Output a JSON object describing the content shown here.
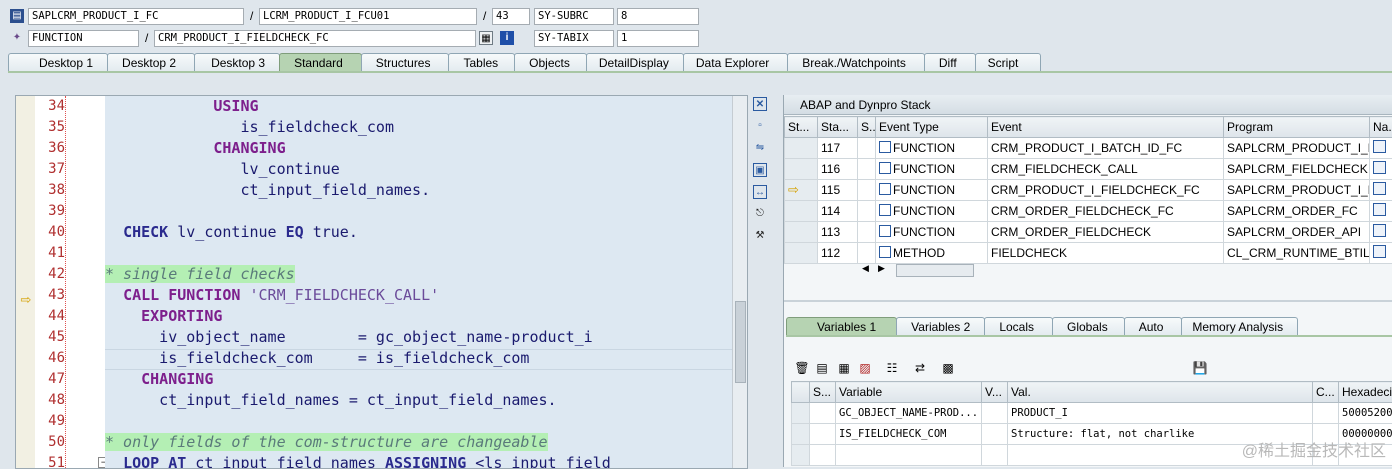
{
  "header": {
    "program": "SAPLCRM_PRODUCT_I_FC",
    "include": "LCRM_PRODUCT_I_FCU01",
    "line": "43",
    "sy_subrc_label": "SY-SUBRC",
    "sy_subrc_value": "8",
    "event_type": "FUNCTION",
    "event_name": "CRM_PRODUCT_I_FIELDCHECK_FC",
    "sy_tabix_label": "SY-TABIX",
    "sy_tabix_value": "1",
    "slash": "/"
  },
  "tabs": [
    {
      "label": "Desktop 1"
    },
    {
      "label": "Desktop 2"
    },
    {
      "label": "Desktop 3"
    },
    {
      "label": "Standard"
    },
    {
      "label": "Structures"
    },
    {
      "label": "Tables"
    },
    {
      "label": "Objects"
    },
    {
      "label": "DetailDisplay"
    },
    {
      "label": "Data Explorer"
    },
    {
      "label": "Break./Watchpoints"
    },
    {
      "label": "Diff"
    },
    {
      "label": "Script"
    }
  ],
  "code": {
    "lines": [
      {
        "num": "34",
        "parts": [
          [
            "sp",
            "            "
          ],
          [
            "kw",
            "USING"
          ]
        ]
      },
      {
        "num": "35",
        "parts": [
          [
            "sp",
            "               is_fieldcheck_com"
          ]
        ]
      },
      {
        "num": "36",
        "parts": [
          [
            "sp",
            "            "
          ],
          [
            "kw",
            "CHANGING"
          ]
        ]
      },
      {
        "num": "37",
        "parts": [
          [
            "sp",
            "               lv_continue"
          ]
        ]
      },
      {
        "num": "38",
        "parts": [
          [
            "sp",
            "               ct_input_field_names."
          ]
        ]
      },
      {
        "num": "39",
        "parts": []
      },
      {
        "num": "40",
        "parts": [
          [
            "sp",
            "  "
          ],
          [
            "kwb",
            "CHECK"
          ],
          [
            "sp",
            " lv_continue "
          ],
          [
            "kwb",
            "EQ"
          ],
          [
            "sp",
            " true."
          ]
        ]
      },
      {
        "num": "41",
        "parts": []
      },
      {
        "num": "42",
        "parts": [
          [
            "cmt",
            "* single field checks"
          ]
        ]
      },
      {
        "num": "43",
        "parts": [
          [
            "sp",
            "  "
          ],
          [
            "kw",
            "CALL FUNCTION"
          ],
          [
            "str",
            " 'CRM_FIELDCHECK_CALL'"
          ]
        ]
      },
      {
        "num": "44",
        "parts": [
          [
            "sp",
            "    "
          ],
          [
            "kw",
            "EXPORTING"
          ]
        ]
      },
      {
        "num": "45",
        "parts": [
          [
            "sp",
            "      iv_object_name        = gc_object_name-product_i"
          ]
        ]
      },
      {
        "num": "46",
        "parts": [
          [
            "sp",
            "      is_fieldcheck_com     = is_fieldcheck_com"
          ]
        ]
      },
      {
        "num": "47",
        "parts": [
          [
            "sp",
            "    "
          ],
          [
            "kw",
            "CHANGING"
          ]
        ]
      },
      {
        "num": "48",
        "parts": [
          [
            "sp",
            "      ct_input_field_names = ct_input_field_names."
          ]
        ]
      },
      {
        "num": "49",
        "parts": []
      },
      {
        "num": "50",
        "parts": [
          [
            "cmt",
            "* only fields of the com-structure are changeable"
          ]
        ]
      },
      {
        "num": "51",
        "parts": [
          [
            "sp",
            "  "
          ],
          [
            "kwb",
            "LOOP AT"
          ],
          [
            "sp",
            " ct_input_field_names "
          ],
          [
            "kwb",
            "ASSIGNING"
          ],
          [
            "sp",
            " <ls_input_field"
          ]
        ]
      }
    ]
  },
  "stack": {
    "title": "ABAP and Dynpro Stack",
    "columns": [
      "St...",
      "Sta...",
      "S...",
      "Event Type",
      "Event",
      "Program",
      "Na..."
    ],
    "rows": [
      {
        "level": "117",
        "type": "FUNCTION",
        "event": "CRM_PRODUCT_I_BATCH_ID_FC",
        "program": "SAPLCRM_PRODUCT_I_FC",
        "current": false
      },
      {
        "level": "116",
        "type": "FUNCTION",
        "event": "CRM_FIELDCHECK_CALL",
        "program": "SAPLCRM_FIELDCHECK",
        "current": false
      },
      {
        "level": "115",
        "type": "FUNCTION",
        "event": "CRM_PRODUCT_I_FIELDCHECK_FC",
        "program": "SAPLCRM_PRODUCT_I_FC",
        "current": true
      },
      {
        "level": "114",
        "type": "FUNCTION",
        "event": "CRM_ORDER_FIELDCHECK_FC",
        "program": "SAPLCRM_ORDER_FC",
        "current": false
      },
      {
        "level": "113",
        "type": "FUNCTION",
        "event": "CRM_ORDER_FIELDCHECK",
        "program": "SAPLCRM_ORDER_API",
        "current": false
      },
      {
        "level": "112",
        "type": "METHOD",
        "event": "FIELDCHECK",
        "program": "CL_CRM_RUNTIME_BTIL...",
        "current": false
      }
    ]
  },
  "var_tabs": [
    {
      "label": "Variables 1"
    },
    {
      "label": "Variables 2"
    },
    {
      "label": "Locals"
    },
    {
      "label": "Globals"
    },
    {
      "label": "Auto"
    },
    {
      "label": "Memory Analysis"
    }
  ],
  "variables": {
    "columns": [
      "S...",
      "Variable",
      "V...",
      "Val.",
      "C...",
      "Hexadeci"
    ],
    "rows": [
      {
        "name": "GC_OBJECT_NAME-PROD...",
        "value": "PRODUCT_I",
        "hex": "50005200"
      },
      {
        "name": "IS_FIELDCHECK_COM",
        "value": "Structure: flat, not charlike",
        "hex": "00000000"
      }
    ]
  },
  "watermark": "@稀土掘金技术社区",
  "colors": {
    "active_tab": "#b6d3b2",
    "editor_bg": "#dde8f2",
    "comment_bg": "#b4efb4",
    "keyword": "#7d1f8c"
  }
}
